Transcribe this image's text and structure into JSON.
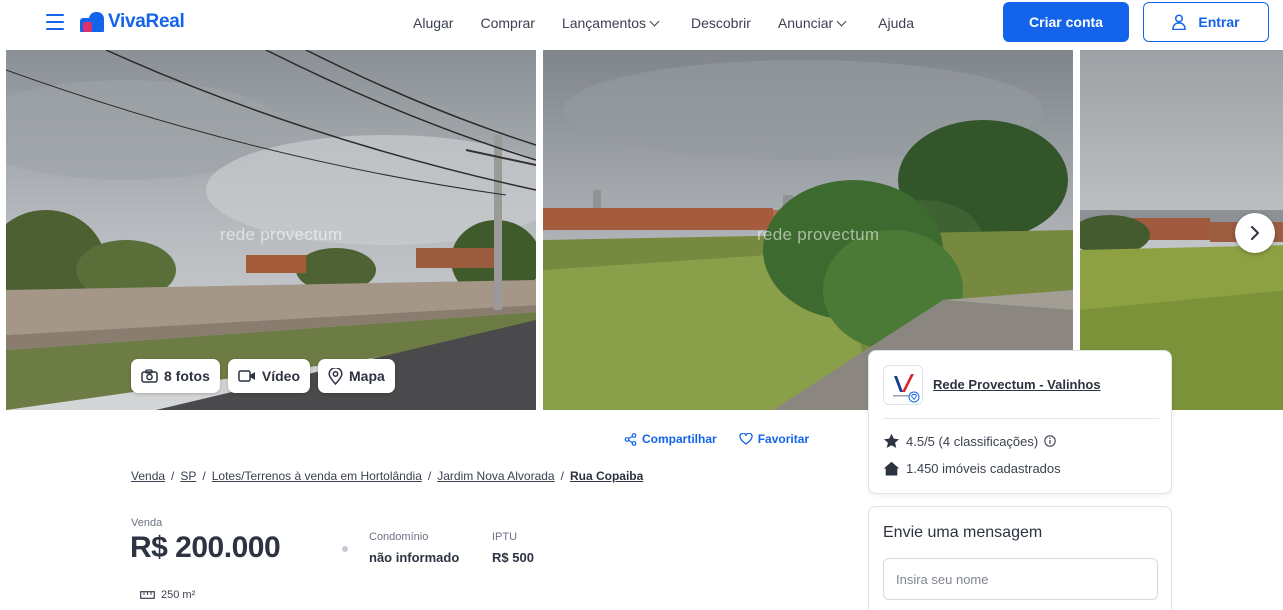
{
  "header": {
    "logo_text": "VivaReal",
    "nav": [
      {
        "label": "Alugar",
        "dropdown": false
      },
      {
        "label": "Comprar",
        "dropdown": false
      },
      {
        "label": "Lançamentos",
        "dropdown": true
      },
      {
        "label": "Descobrir",
        "dropdown": false
      },
      {
        "label": "Anunciar",
        "dropdown": true
      },
      {
        "label": "Ajuda",
        "dropdown": false
      }
    ],
    "create_account_label": "Criar conta",
    "login_label": "Entrar"
  },
  "gallery": {
    "watermark": "rede provectum",
    "photos_label": "8 fotos",
    "video_label": "Vídeo",
    "map_label": "Mapa"
  },
  "actions": {
    "share_label": "Compartilhar",
    "favorite_label": "Favoritar"
  },
  "breadcrumb": {
    "items": [
      "Venda",
      "SP",
      "Lotes/Terrenos à venda em Hortolândia",
      "Jardim Nova Alvorada"
    ],
    "current": "Rua Copaiba"
  },
  "listing": {
    "transaction": "Venda",
    "price": "R$ 200.000",
    "condo_label": "Condomínio",
    "condo_value": "não informado",
    "iptu_label": "IPTU",
    "iptu_value": "R$ 500",
    "area": "250 m²"
  },
  "agency": {
    "name": "Rede Provectum - Valinhos",
    "rating": "4.5/5 (4 classificações)",
    "listings": "1.450 imóveis cadastrados"
  },
  "message": {
    "title": "Envie uma mensagem",
    "name_placeholder": "Insira seu nome"
  },
  "colors": {
    "brand_blue": "#1364ea",
    "brand_pink": "#e0306a",
    "text_dark": "#2d3340"
  }
}
